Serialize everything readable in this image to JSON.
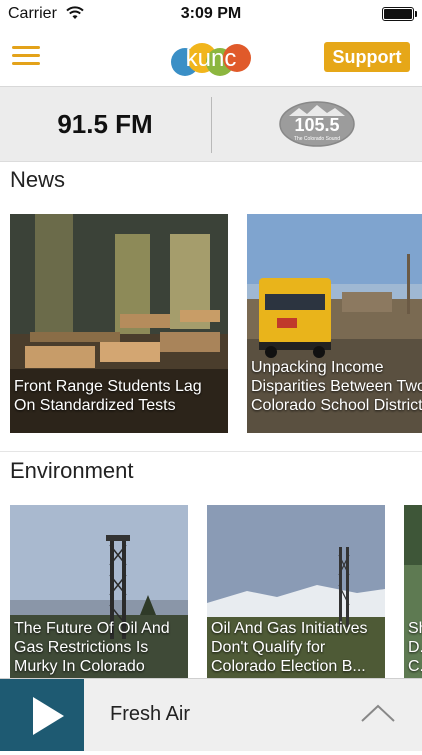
{
  "status_bar": {
    "carrier": "Carrier",
    "time": "3:09 PM"
  },
  "nav": {
    "support_label": "Support",
    "logo_text": "kunc"
  },
  "stations": {
    "primary": "91.5 FM",
    "secondary_logo_text": "105.5",
    "secondary_logo_subtext": "The Colorado Sound"
  },
  "sections": [
    {
      "title": "News",
      "cards": [
        {
          "headline": "Front Range Students Lag On Standardized Tests"
        },
        {
          "headline": "Unpacking Income Disparities Between Two Colorado School Districts"
        }
      ]
    },
    {
      "title": "Environment",
      "cards": [
        {
          "headline": "The Future Of Oil And Gas Restrictions Is Murky In Colorado"
        },
        {
          "headline": "Oil And Gas Initiatives Don't Qualify for Colorado Election B..."
        },
        {
          "headline": "Sh... D... C..."
        }
      ]
    }
  ],
  "player": {
    "now_playing": "Fresh Air"
  },
  "colors": {
    "accent": "#e6a718",
    "player_button": "#1e5a72"
  }
}
